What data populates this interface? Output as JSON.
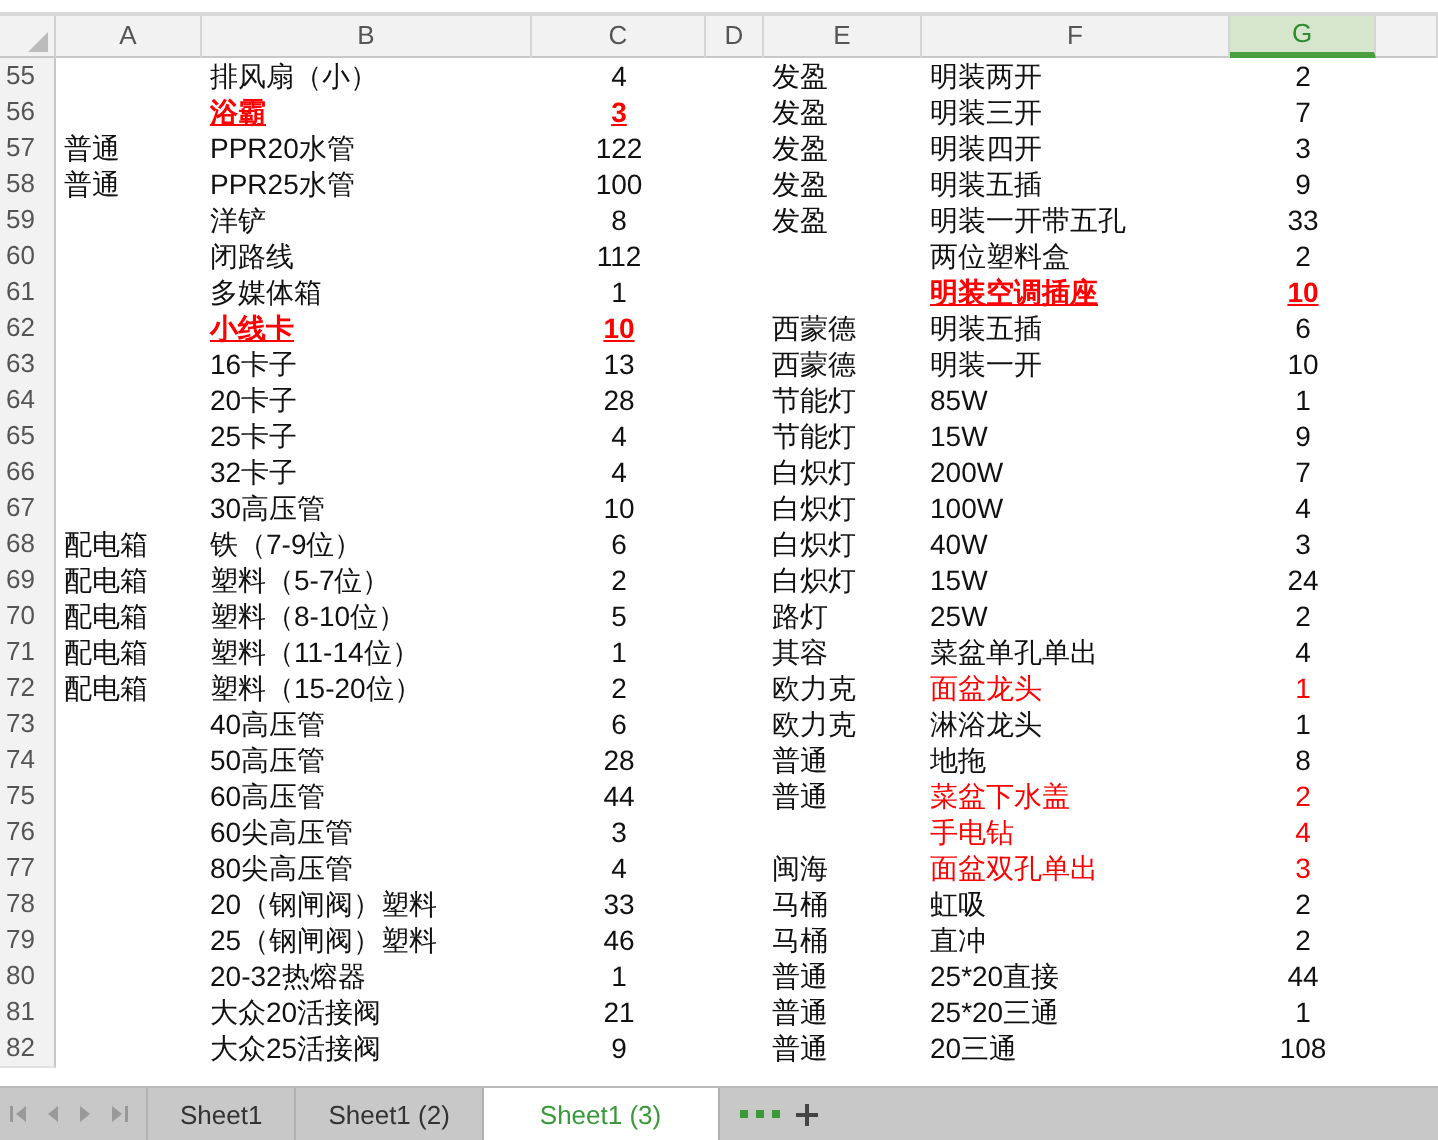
{
  "columns": [
    {
      "label": "A",
      "selected": false
    },
    {
      "label": "B",
      "selected": false
    },
    {
      "label": "C",
      "selected": false
    },
    {
      "label": "D",
      "selected": false
    },
    {
      "label": "E",
      "selected": false
    },
    {
      "label": "F",
      "selected": false
    },
    {
      "label": "G",
      "selected": true
    }
  ],
  "rows": [
    {
      "n": "55",
      "b": "排风扇（小）",
      "c": "4",
      "e": "发盈",
      "f": "明装两开",
      "g": "2",
      "bc_red": false,
      "bc_bold": false,
      "fg_red": false,
      "fg_bold": false
    },
    {
      "n": "56",
      "b": "浴霸",
      "c": "3",
      "e": "发盈",
      "f": "明装三开",
      "g": "7",
      "bc_red": true,
      "bc_bold": true,
      "fg_red": false,
      "fg_bold": false
    },
    {
      "n": "57",
      "a": "普通",
      "b": "PPR20水管",
      "c": "122",
      "e": "发盈",
      "f": "明装四开",
      "g": "3",
      "bc_red": false,
      "bc_bold": false,
      "fg_red": false,
      "fg_bold": false
    },
    {
      "n": "58",
      "a": "普通",
      "b": "PPR25水管",
      "c": "100",
      "e": "发盈",
      "f": "明装五插",
      "g": "9",
      "bc_red": false,
      "bc_bold": false,
      "fg_red": false,
      "fg_bold": false
    },
    {
      "n": "59",
      "b": "洋铲",
      "c": "8",
      "e": "发盈",
      "f": "明装一开带五孔",
      "g": "33",
      "bc_red": false,
      "bc_bold": false,
      "fg_red": false,
      "fg_bold": false
    },
    {
      "n": "60",
      "b": "闭路线",
      "c": "112",
      "f": "两位塑料盒",
      "g": "2",
      "bc_red": false,
      "bc_bold": false,
      "fg_red": false,
      "fg_bold": false
    },
    {
      "n": "61",
      "b": "多媒体箱",
      "c": "1",
      "f": "明装空调插座",
      "g": "10",
      "bc_red": false,
      "bc_bold": false,
      "fg_red": true,
      "fg_bold": true
    },
    {
      "n": "62",
      "b": "小线卡",
      "c": "10",
      "e": "西蒙德",
      "f": "明装五插",
      "g": "6",
      "bc_red": true,
      "bc_bold": true,
      "fg_red": false,
      "fg_bold": false
    },
    {
      "n": "63",
      "b": "16卡子",
      "c": "13",
      "e": "西蒙德",
      "f": "明装一开",
      "g": "10",
      "bc_red": false,
      "bc_bold": false,
      "fg_red": false,
      "fg_bold": false
    },
    {
      "n": "64",
      "b": "20卡子",
      "c": "28",
      "e": "节能灯",
      "f": "85W",
      "g": "1",
      "bc_red": false,
      "bc_bold": false,
      "fg_red": false,
      "fg_bold": false
    },
    {
      "n": "65",
      "b": "25卡子",
      "c": "4",
      "e": "节能灯",
      "f": "15W",
      "g": "9",
      "bc_red": false,
      "bc_bold": false,
      "fg_red": false,
      "fg_bold": false
    },
    {
      "n": "66",
      "b": "32卡子",
      "c": "4",
      "e": "白炽灯",
      "f": "200W",
      "g": "7",
      "bc_red": false,
      "bc_bold": false,
      "fg_red": false,
      "fg_bold": false
    },
    {
      "n": "67",
      "b": "30高压管",
      "c": "10",
      "e": "白炽灯",
      "f": "100W",
      "g": "4",
      "bc_red": false,
      "bc_bold": false,
      "fg_red": false,
      "fg_bold": false
    },
    {
      "n": "68",
      "a": "配电箱",
      "b": "铁（7-9位）",
      "c": "6",
      "e": "白炽灯",
      "f": "40W",
      "g": "3",
      "bc_red": false,
      "bc_bold": false,
      "fg_red": false,
      "fg_bold": false
    },
    {
      "n": "69",
      "a": "配电箱",
      "b": "塑料（5-7位）",
      "c": "2",
      "e": "白炽灯",
      "f": "15W",
      "g": "24",
      "bc_red": false,
      "bc_bold": false,
      "fg_red": false,
      "fg_bold": false
    },
    {
      "n": "70",
      "a": "配电箱",
      "b": "塑料（8-10位）",
      "c": "5",
      "e": "路灯",
      "f": "25W",
      "g": "2",
      "bc_red": false,
      "bc_bold": false,
      "fg_red": false,
      "fg_bold": false
    },
    {
      "n": "71",
      "a": "配电箱",
      "b": "塑料（11-14位）",
      "c": "1",
      "e": "其容",
      "f": "菜盆单孔单出",
      "g": "4",
      "bc_red": false,
      "bc_bold": false,
      "fg_red": false,
      "fg_bold": false
    },
    {
      "n": "72",
      "a": "配电箱",
      "b": "塑料（15-20位）",
      "c": "2",
      "e": "欧力克",
      "f": "面盆龙头",
      "g": "1",
      "bc_red": false,
      "bc_bold": false,
      "fg_red": true,
      "fg_bold": false
    },
    {
      "n": "73",
      "b": "40高压管",
      "c": "6",
      "e": "欧力克",
      "f": "淋浴龙头",
      "g": "1",
      "bc_red": false,
      "bc_bold": false,
      "fg_red": false,
      "fg_bold": false
    },
    {
      "n": "74",
      "b": "50高压管",
      "c": "28",
      "e": "普通",
      "f": "地拖",
      "g": "8",
      "bc_red": false,
      "bc_bold": false,
      "fg_red": false,
      "fg_bold": false
    },
    {
      "n": "75",
      "b": "60高压管",
      "c": "44",
      "e": "普通",
      "f": "菜盆下水盖",
      "g": "2",
      "bc_red": false,
      "bc_bold": false,
      "fg_red": true,
      "fg_bold": false
    },
    {
      "n": "76",
      "b": "60尖高压管",
      "c": "3",
      "f": "手电钻",
      "g": "4",
      "bc_red": false,
      "bc_bold": false,
      "fg_red": true,
      "fg_bold": false
    },
    {
      "n": "77",
      "b": "80尖高压管",
      "c": "4",
      "e": "闽海",
      "f": "面盆双孔单出",
      "g": "3",
      "bc_red": false,
      "bc_bold": false,
      "fg_red": true,
      "fg_bold": false
    },
    {
      "n": "78",
      "b": "20（钢闸阀）塑料",
      "c": "33",
      "e": "马桶",
      "f": "虹吸",
      "g": "2",
      "bc_red": false,
      "bc_bold": false,
      "fg_red": false,
      "fg_bold": false
    },
    {
      "n": "79",
      "b": "25（钢闸阀）塑料",
      "c": "46",
      "e": "马桶",
      "f": "直冲",
      "g": "2",
      "bc_red": false,
      "bc_bold": false,
      "fg_red": false,
      "fg_bold": false
    },
    {
      "n": "80",
      "b": "20-32热熔器",
      "c": "1",
      "e": "普通",
      "f": "25*20直接",
      "g": "44",
      "bc_red": false,
      "bc_bold": false,
      "fg_red": false,
      "fg_bold": false
    },
    {
      "n": "81",
      "b": "大众20活接阀",
      "c": "21",
      "e": "普通",
      "f": "25*20三通",
      "g": "1",
      "bc_red": false,
      "bc_bold": false,
      "fg_red": false,
      "fg_bold": false
    },
    {
      "n": "82",
      "b": "大众25活接阀",
      "c": "9",
      "e": "普通",
      "f": "20三通",
      "g": "108",
      "bc_red": false,
      "bc_bold": false,
      "fg_red": false,
      "fg_bold": false
    }
  ],
  "sheet_tabs": [
    {
      "label": "Sheet1",
      "selected": false
    },
    {
      "label": "Sheet1 (2)",
      "selected": false
    },
    {
      "label": "Sheet1 (3)",
      "selected": true
    }
  ]
}
